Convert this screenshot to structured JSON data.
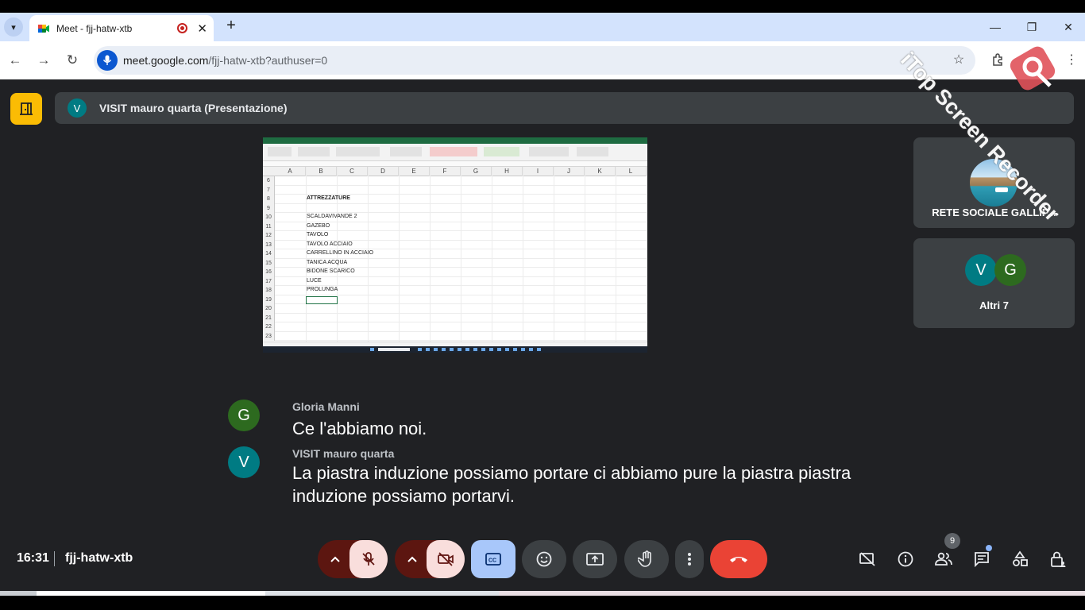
{
  "browser": {
    "tab_title": "Meet - fjj-hatw-xtb",
    "url_host": "meet.google.com",
    "url_path": "/fjj-hatw-xtb?authuser=0"
  },
  "meet": {
    "presenter_initial": "V",
    "presenter_label": "VISIT mauro quarta (Presentazione)",
    "spreadsheet": {
      "columns": [
        "A",
        "B",
        "C",
        "D",
        "E",
        "F",
        "G",
        "H",
        "I",
        "J",
        "K",
        "L"
      ],
      "rows": [
        {
          "n": "6",
          "v": ""
        },
        {
          "n": "7",
          "v": ""
        },
        {
          "n": "8",
          "v": "ATTREZZATURE",
          "bold": true
        },
        {
          "n": "9",
          "v": ""
        },
        {
          "n": "10",
          "v": "SCALDAVIVANDE 2"
        },
        {
          "n": "11",
          "v": "GAZEBO"
        },
        {
          "n": "12",
          "v": "TAVOLO"
        },
        {
          "n": "13",
          "v": "TAVOLO ACCIAIO"
        },
        {
          "n": "14",
          "v": "CARRELLINO IN ACCIAIO"
        },
        {
          "n": "15",
          "v": "TANICA ACQUA"
        },
        {
          "n": "16",
          "v": "BIDONE SCARICO"
        },
        {
          "n": "17",
          "v": "LUCE"
        },
        {
          "n": "18",
          "v": "PROLUNGA"
        },
        {
          "n": "19",
          "v": ""
        },
        {
          "n": "20",
          "v": ""
        },
        {
          "n": "21",
          "v": ""
        },
        {
          "n": "22",
          "v": ""
        },
        {
          "n": "23",
          "v": ""
        }
      ]
    },
    "tiles": [
      {
        "name": "RETE SOCIALE GALLIP..."
      },
      {
        "name": "Altri 7",
        "initials": [
          "V",
          "G"
        ]
      }
    ],
    "captions": [
      {
        "initial": "G",
        "speaker": "Gloria Manni",
        "text": "Ce l'abbiamo noi.",
        "color": "#2d6a1f"
      },
      {
        "initial": "V",
        "speaker": "VISIT mauro quarta",
        "text": "La piastra induzione possiamo portare ci abbiamo pure la piastra piastra induzione possiamo portarvi.",
        "color": "#007b83"
      }
    ],
    "time": "16:31",
    "meeting_code": "fjj-hatw-xtb",
    "participants_count": "9"
  },
  "watermark": "iTop Screen Recorder",
  "colors": {
    "accent": "#a8c7fa",
    "hangup": "#ea4335",
    "exit": "#fbbc04",
    "bg": "#202124"
  }
}
